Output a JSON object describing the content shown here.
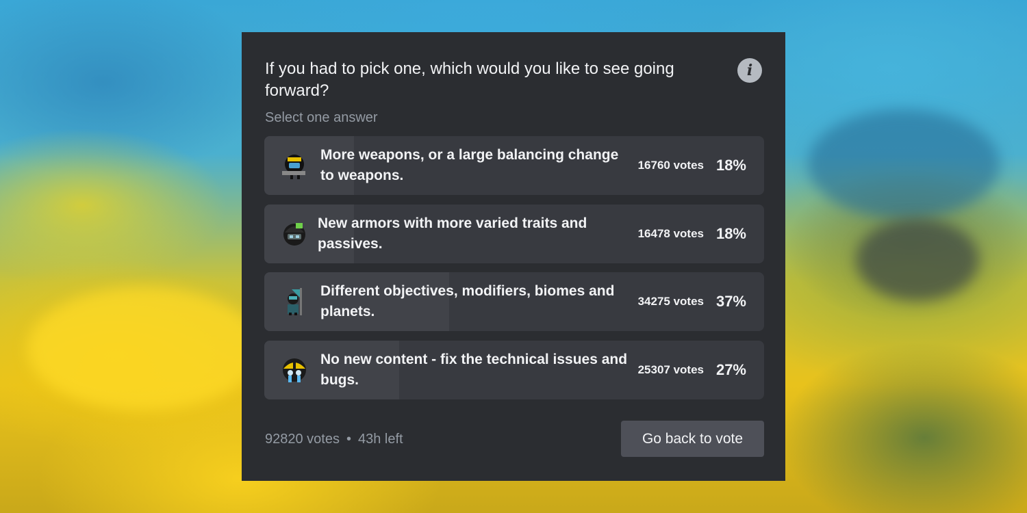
{
  "poll": {
    "question": "If you had to pick one, which would you like to see going forward?",
    "instruction": "Select one answer",
    "answers": [
      {
        "text": "More weapons, or a large balancing change to weapons.",
        "votes": "16760 votes",
        "percent": "18%",
        "fraction": 0.18,
        "emoji": "soldier-with-gun-emoji"
      },
      {
        "text": "New armors with more varied traits and passives.",
        "votes": "16478 votes",
        "percent": "18%",
        "fraction": 0.18,
        "emoji": "green-helmet-soldier-emoji"
      },
      {
        "text": "Different objectives, modifiers, biomes and planets.",
        "votes": "34275 votes",
        "percent": "37%",
        "fraction": 0.37,
        "emoji": "soldier-with-flag-emoji"
      },
      {
        "text": "No new content - fix the technical issues and bugs.",
        "votes": "25307 votes",
        "percent": "27%",
        "fraction": 0.27,
        "emoji": "crying-soldier-emoji"
      }
    ],
    "total_votes": "92820 votes",
    "separator": "•",
    "time_left": "43h left",
    "back_button": "Go back to vote",
    "info_icon": "info-icon"
  },
  "colors": {
    "panel": "#2b2d31",
    "answer_bg": "#383a40",
    "answer_fill": "#414349",
    "button": "#4e5058",
    "text": "#f2f3f5",
    "muted": "#949ba4"
  }
}
